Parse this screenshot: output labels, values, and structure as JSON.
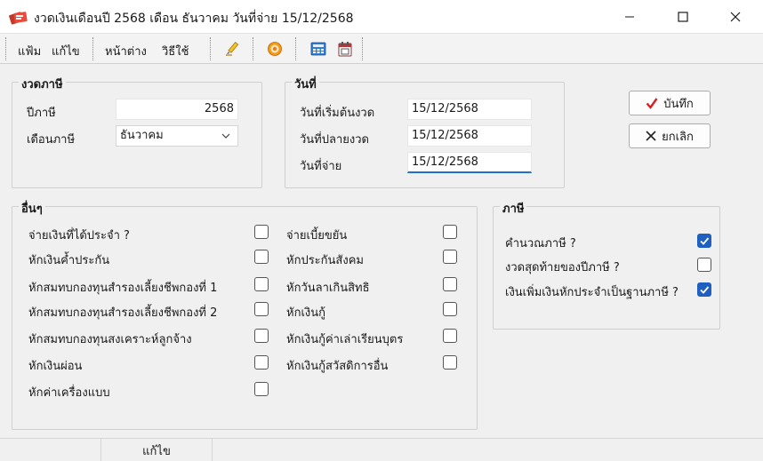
{
  "window": {
    "title": "งวดเงินเดือนปี 2568 เดือน ธันวาคม วันที่จ่าย 15/12/2568",
    "minimize_icon": "minimize-icon",
    "maximize_icon": "maximize-icon",
    "close_icon": "close-icon"
  },
  "toolbar": {
    "menu_file": "แฟ้ม",
    "menu_edit": "แก้ไข",
    "menu_window": "หน้าต่าง",
    "menu_howto": "วิธีใช้",
    "icons": [
      "edit-pen-icon",
      "target-icon",
      "calculator-icon",
      "calendar-icon"
    ]
  },
  "tax_period": {
    "title": "งวดภาษี",
    "year_label": "ปีภาษี",
    "year_value": "2568",
    "month_label": "เดือนภาษี",
    "month_value": "ธันวาคม"
  },
  "dates": {
    "title": "วันที่",
    "start_label": "วันที่เริ่มต้นงวด",
    "start_value": "15/12/2568",
    "end_label": "วันที่ปลายงวด",
    "end_value": "15/12/2568",
    "pay_label": "วันที่จ่าย",
    "pay_value": "15/12/2568"
  },
  "actions": {
    "save_label": "บันทึก",
    "cancel_label": "ยกเลิก"
  },
  "others": {
    "title": "อื่นๆ",
    "left": [
      {
        "label": "จ่ายเงินที่ได้ประจำ ?",
        "checked": false
      },
      {
        "label": "หักเงินค้ำประกัน",
        "checked": false
      },
      {
        "label": "หักสมทบกองทุนสำรองเลี้ยงชีพกองที่ 1",
        "checked": false
      },
      {
        "label": "หักสมทบกองทุนสำรองเลี้ยงชีพกองที่ 2",
        "checked": false
      },
      {
        "label": "หักสมทบกองทุนสงเคราะห์ลูกจ้าง",
        "checked": false
      },
      {
        "label": "หักเงินผ่อน",
        "checked": false
      },
      {
        "label": "หักค่าเครื่องแบบ",
        "checked": false
      }
    ],
    "right": [
      {
        "label": "จ่ายเบี้ยขยัน",
        "checked": false
      },
      {
        "label": "หักประกันสังคม",
        "checked": false
      },
      {
        "label": "หักวันลาเกินสิทธิ",
        "checked": false
      },
      {
        "label": "หักเงินกู้",
        "checked": false
      },
      {
        "label": "หักเงินกู้ค่าเล่าเรียนบุตร",
        "checked": false
      },
      {
        "label": "หักเงินกู้สวัสดิการอื่น",
        "checked": false
      }
    ]
  },
  "tax": {
    "title": "ภาษี",
    "items": [
      {
        "label": "คำนวณภาษี ?",
        "checked": true
      },
      {
        "label": "งวดสุดท้ายของปีภาษี ?",
        "checked": false
      },
      {
        "label": "เงินเพิ่มเงินหักประจำเป็นฐานภาษี ?",
        "checked": true
      }
    ]
  },
  "statusbar": {
    "mode": "แก้ไข"
  },
  "colors": {
    "accent": "#1f5fbf",
    "save_check": "#d42020",
    "background": "#f0f0f0"
  }
}
